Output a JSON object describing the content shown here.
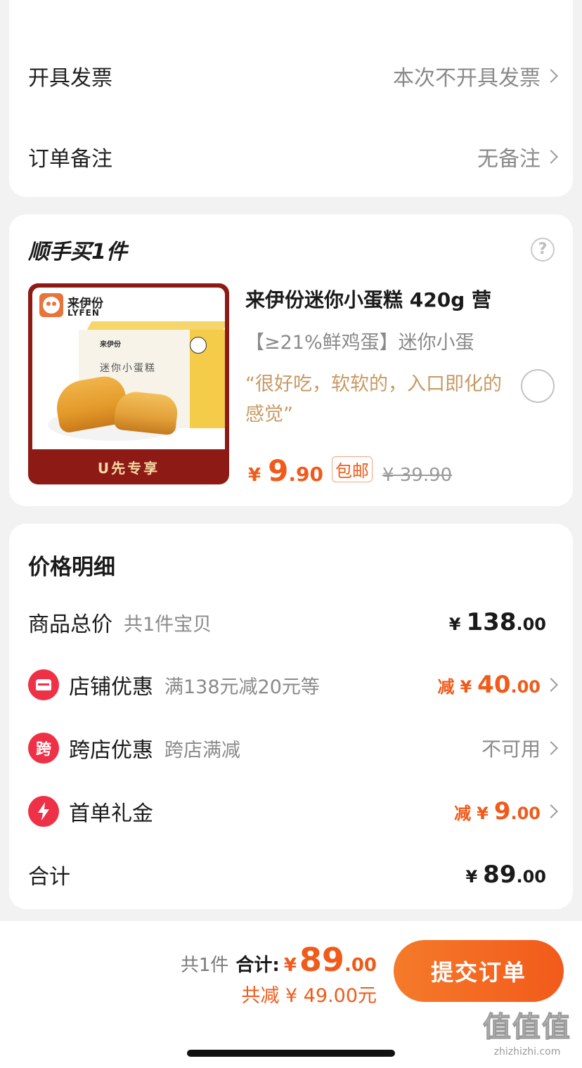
{
  "invoice": {
    "label": "开具发票",
    "value": "本次不开具发票"
  },
  "remark": {
    "label": "订单备注",
    "value": "无备注"
  },
  "addon": {
    "title": "顺手买1件",
    "help_symbol": "?",
    "image": {
      "brand_cn": "来伊份",
      "brand_en": "LYFEN",
      "box_name": "迷你小蛋糕",
      "ribbon": "U先专享"
    },
    "product_title": "来伊份迷你小蛋糕 420g 营",
    "product_sub": "【≥21%鲜鸡蛋】迷你小蛋",
    "review": "“很好吃，软软的，入口即化的感觉”",
    "price_currency": "¥",
    "price_int": "9",
    "price_dec": ".90",
    "free_shipping": "包邮",
    "original_price": "¥ 39.90"
  },
  "price_detail": {
    "title": "价格明细",
    "goods": {
      "label": "商品总价",
      "sub": "共1件宝贝",
      "currency": "¥",
      "int": "138",
      "dec": ".00"
    },
    "shop": {
      "label": "店铺优惠",
      "sub": "满138元减20元等",
      "prefix": "减",
      "currency": "¥",
      "int": "40",
      "dec": ".00"
    },
    "cross": {
      "label": "跨店优惠",
      "sub": "跨店满减",
      "icon_text": "跨",
      "value": "不可用"
    },
    "first": {
      "label": "首单礼金",
      "prefix": "减",
      "currency": "¥",
      "int": "9",
      "dec": ".00"
    },
    "total": {
      "label": "合计",
      "currency": "¥",
      "int": "89",
      "dec": ".00"
    }
  },
  "bottom": {
    "count": "共1件",
    "total_label": "合计:",
    "currency": "¥",
    "total_int": "89",
    "total_dec": ".00",
    "saved": "共减 ¥ 49.00元",
    "submit": "提交订单"
  },
  "watermark": {
    "big": "值值值",
    "small": "zhizhizhi.com"
  },
  "colors": {
    "accent": "#f05a1a",
    "icon_red": "#ee3146",
    "review": "#c79a64",
    "ribbon": "#8d1a14"
  }
}
